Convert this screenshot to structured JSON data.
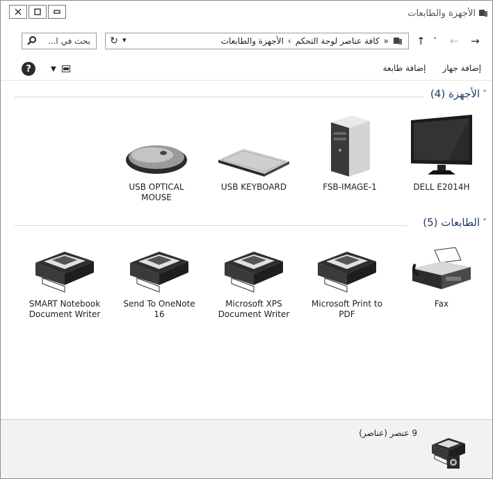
{
  "window": {
    "title": "الأجهزة والطابعات"
  },
  "nav": {
    "address_segments": [
      "«",
      "كافة عناصر لوحة التحكم",
      "›",
      "الأجهزة والطابعات"
    ],
    "search_placeholder": "بحث في ا..."
  },
  "toolbar": {
    "add_device": "إضافة جهاز",
    "add_printer": "إضافة طابعة"
  },
  "sections": {
    "devices": {
      "title": "الأجهزة (4)"
    },
    "printers": {
      "title": "الطابعات (5)"
    }
  },
  "devices": [
    {
      "label": "DELL E2014H",
      "icon": "monitor-icon"
    },
    {
      "label": "FSB-IMAGE-1",
      "icon": "computer-tower-icon"
    },
    {
      "label": "USB KEYBOARD",
      "icon": "keyboard-icon"
    },
    {
      "label": "USB OPTICAL MOUSE",
      "icon": "mouse-icon"
    }
  ],
  "printers": [
    {
      "label": "Fax",
      "icon": "fax-icon"
    },
    {
      "label": "Microsoft Print to PDF",
      "icon": "printer-icon"
    },
    {
      "label": "Microsoft XPS Document Writer",
      "icon": "printer-icon"
    },
    {
      "label": "Send To OneNote 16",
      "icon": "printer-icon"
    },
    {
      "label": "SMART Notebook Document Writer",
      "icon": "printer-icon"
    }
  ],
  "status": {
    "count_text": "9 عنصر (عناصر)"
  }
}
